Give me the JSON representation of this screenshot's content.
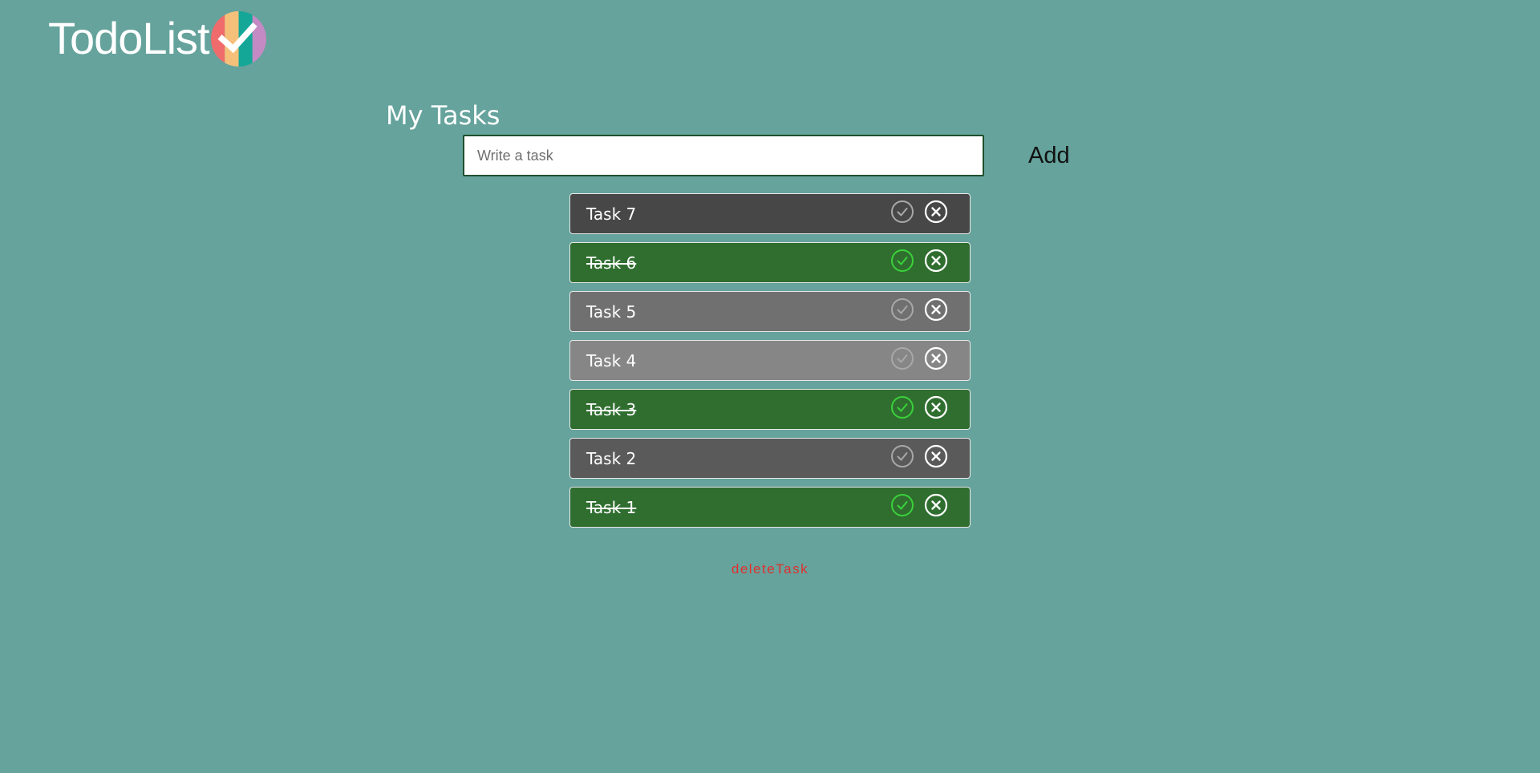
{
  "header": {
    "logo_text": "TodoList",
    "logo_icon": "check-badge-icon"
  },
  "main": {
    "title": "My Tasks",
    "input": {
      "value": "",
      "placeholder": "Write a task"
    },
    "add_label": "Add",
    "tasks": [
      {
        "label": "Task 7",
        "completed": false,
        "color": "#474747"
      },
      {
        "label": "Task 6",
        "completed": true,
        "color": "#2f6e2f"
      },
      {
        "label": "Task 5",
        "completed": false,
        "color": "#707070"
      },
      {
        "label": "Task 4",
        "completed": false,
        "color": "#868686"
      },
      {
        "label": "Task 3",
        "completed": true,
        "color": "#2f6e2f"
      },
      {
        "label": "Task 2",
        "completed": false,
        "color": "#5a5a5a"
      },
      {
        "label": "Task 1",
        "completed": true,
        "color": "#2f6e2f"
      }
    ],
    "delete_label": "deleteTask"
  },
  "colors": {
    "background": "#65a39c",
    "done_check": "#3bd13b",
    "pending_check": "#a8a8a8",
    "delete_text": "#e0302e"
  },
  "icons": {
    "complete": "check-circle-icon",
    "remove": "x-circle-icon"
  }
}
